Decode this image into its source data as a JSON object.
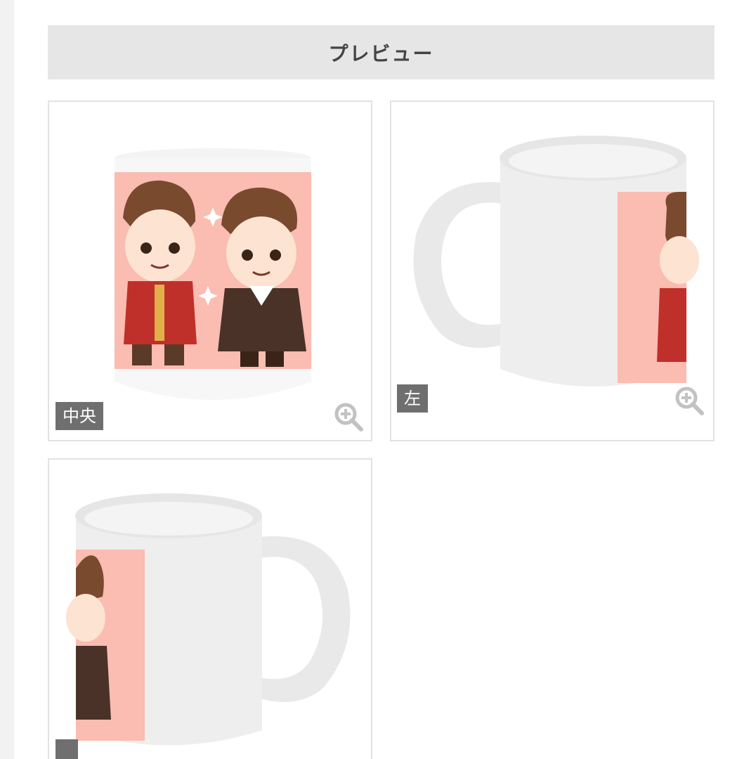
{
  "header": {
    "title": "プレビュー"
  },
  "previews": [
    {
      "label": "中央"
    },
    {
      "label": "左"
    },
    {
      "label": ""
    }
  ],
  "colors": {
    "panel_header": "#e6e6e6",
    "badge": "#6f6f6f",
    "mug_print": "#fbbcb2",
    "mug_body": "#eeeeee",
    "zoom_icon": "#c2c2c2"
  },
  "icons": {
    "zoom": "zoom-in-icon"
  }
}
